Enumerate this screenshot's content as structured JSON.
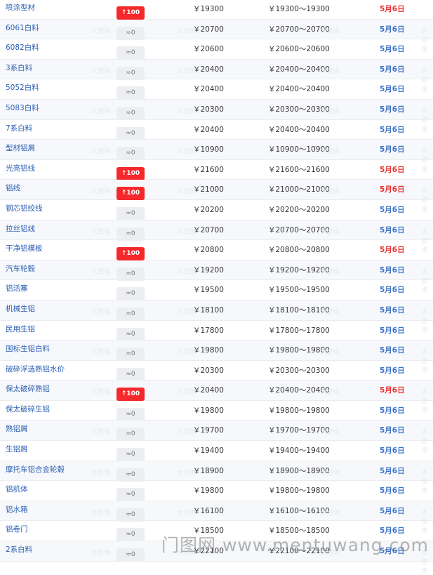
{
  "rows": [
    {
      "name": "喷涂型材",
      "change": "↑100",
      "up": true,
      "price": "￥19300",
      "range": "￥19300～19300",
      "date": "5月6日"
    },
    {
      "name": "6061白料",
      "change": "≈0",
      "up": false,
      "price": "￥20700",
      "range": "￥20700～20700",
      "date": "5月6日"
    },
    {
      "name": "6082白料",
      "change": "≈0",
      "up": false,
      "price": "￥20600",
      "range": "￥20600～20600",
      "date": "5月6日"
    },
    {
      "name": "3系白料",
      "change": "≈0",
      "up": false,
      "price": "￥20400",
      "range": "￥20400～20400",
      "date": "5月6日"
    },
    {
      "name": "5052白料",
      "change": "≈0",
      "up": false,
      "price": "￥20400",
      "range": "￥20400～20400",
      "date": "5月6日"
    },
    {
      "name": "5083白料",
      "change": "≈0",
      "up": false,
      "price": "￥20300",
      "range": "￥20300～20300",
      "date": "5月6日"
    },
    {
      "name": "7系白料",
      "change": "≈0",
      "up": false,
      "price": "￥20400",
      "range": "￥20400～20400",
      "date": "5月6日"
    },
    {
      "name": "型材铝屑",
      "change": "≈0",
      "up": false,
      "price": "￥10900",
      "range": "￥10900～10900",
      "date": "5月6日"
    },
    {
      "name": "光亮铝线",
      "change": "↑100",
      "up": true,
      "price": "￥21600",
      "range": "￥21600～21600",
      "date": "5月6日"
    },
    {
      "name": "铝线",
      "change": "↑100",
      "up": true,
      "price": "￥21000",
      "range": "￥21000～21000",
      "date": "5月6日"
    },
    {
      "name": "钢芯铝绞线",
      "change": "≈0",
      "up": false,
      "price": "￥20200",
      "range": "￥20200～20200",
      "date": "5月6日"
    },
    {
      "name": "拉丝铝线",
      "change": "≈0",
      "up": false,
      "price": "￥20700",
      "range": "￥20700～20700",
      "date": "5月6日"
    },
    {
      "name": "干净铝模板",
      "change": "↑100",
      "up": true,
      "price": "￥20800",
      "range": "￥20800～20800",
      "date": "5月6日"
    },
    {
      "name": "汽车轮毂",
      "change": "≈0",
      "up": false,
      "price": "￥19200",
      "range": "￥19200～19200",
      "date": "5月6日"
    },
    {
      "name": "铝活塞",
      "change": "≈0",
      "up": false,
      "price": "￥19500",
      "range": "￥19500～19500",
      "date": "5月6日"
    },
    {
      "name": "机械生铝",
      "change": "≈0",
      "up": false,
      "price": "￥18100",
      "range": "￥18100～18100",
      "date": "5月6日"
    },
    {
      "name": "民用生铝",
      "change": "≈0",
      "up": false,
      "price": "￥17800",
      "range": "￥17800～17800",
      "date": "5月6日"
    },
    {
      "name": "国标生铝白料",
      "change": "≈0",
      "up": false,
      "price": "￥19800",
      "range": "￥19800～19800",
      "date": "5月6日"
    },
    {
      "name": "破碎浮选熟铝水价",
      "change": "≈0",
      "up": false,
      "price": "￥20300",
      "range": "￥20300～20300",
      "date": "5月6日"
    },
    {
      "name": "保太破碎熟铝",
      "change": "↑100",
      "up": true,
      "price": "￥20400",
      "range": "￥20400～20400",
      "date": "5月6日"
    },
    {
      "name": "保太破碎生铝",
      "change": "≈0",
      "up": false,
      "price": "￥19800",
      "range": "￥19800～19800",
      "date": "5月6日"
    },
    {
      "name": "熟铝屑",
      "change": "≈0",
      "up": false,
      "price": "￥19700",
      "range": "￥19700～19700",
      "date": "5月6日"
    },
    {
      "name": "生铝屑",
      "change": "≈0",
      "up": false,
      "price": "￥19400",
      "range": "￥19400～19400",
      "date": "5月6日"
    },
    {
      "name": "摩托车铝合金轮毂",
      "change": "≈0",
      "up": false,
      "price": "￥18900",
      "range": "￥18900～18900",
      "date": "5月6日"
    },
    {
      "name": "铝机体",
      "change": "≈0",
      "up": false,
      "price": "￥19800",
      "range": "￥19800～19800",
      "date": "5月6日"
    },
    {
      "name": "铝水箱",
      "change": "≈0",
      "up": false,
      "price": "￥16100",
      "range": "￥16100～16100",
      "date": "5月6日"
    },
    {
      "name": "铝卷门",
      "change": "≈0",
      "up": false,
      "price": "￥18500",
      "range": "￥18500～18500",
      "date": "5月6日"
    },
    {
      "name": "2系白料",
      "change": "≈0",
      "up": false,
      "price": "￥22100",
      "range": "￥22100～22100",
      "date": "5月6日"
    }
  ],
  "watermark": "门图网 www.mentuwang.com",
  "row_watermark": "大咨询",
  "colors": {
    "up_badge": "#f5292c",
    "flat_badge": "#eceef2",
    "name_link": "#2b5fb4",
    "date_flat": "#3d73c9",
    "date_up": "#e8302f"
  }
}
